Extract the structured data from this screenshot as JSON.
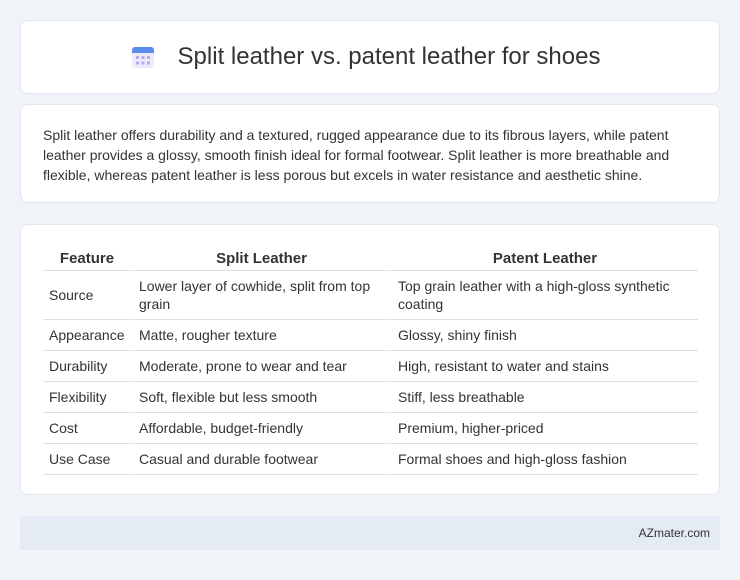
{
  "header": {
    "title": "Split leather vs. patent leather for shoes",
    "icon": "calendar-icon"
  },
  "summary": {
    "text": "Split leather offers durability and a textured, rugged appearance due to its fibrous layers, while patent leather provides a glossy, smooth finish ideal for formal footwear. Split leather is more breathable and flexible, whereas patent leather is less porous but excels in water resistance and aesthetic shine."
  },
  "table": {
    "headers": [
      "Feature",
      "Split Leather",
      "Patent Leather"
    ],
    "rows": [
      [
        "Source",
        "Lower layer of cowhide, split from top grain",
        "Top grain leather with a high-gloss synthetic coating"
      ],
      [
        "Appearance",
        "Matte, rougher texture",
        "Glossy, shiny finish"
      ],
      [
        "Durability",
        "Moderate, prone to wear and tear",
        "High, resistant to water and stains"
      ],
      [
        "Flexibility",
        "Soft, flexible but less smooth",
        "Stiff, less breathable"
      ],
      [
        "Cost",
        "Affordable, budget-friendly",
        "Premium, higher-priced"
      ],
      [
        "Use Case",
        "Casual and durable footwear",
        "Formal shoes and high-gloss fashion"
      ]
    ]
  },
  "footer": {
    "brand": "AZmater.com"
  }
}
